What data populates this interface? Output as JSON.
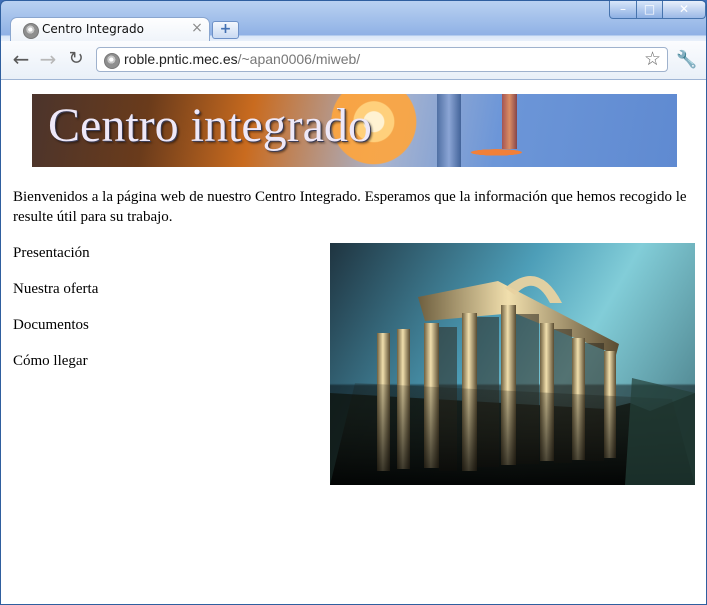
{
  "browser": {
    "tab_title": "Centro Integrado",
    "tab_close": "×",
    "new_tab": "+",
    "window_controls": {
      "minimize": "–",
      "maximize": "□",
      "close": "✕"
    },
    "url_host": "roble.pntic.mec.es",
    "url_path": "/~apan0006/miweb/",
    "icons": {
      "back": "←",
      "forward": "→",
      "reload": "↻",
      "star": "☆",
      "wrench": "🔧"
    }
  },
  "page": {
    "banner_title": "Centro integrado",
    "intro": "Bienvenidos a la página web de nuestro Centro Integrado. Esperamos que la información que hemos recogido le resulte útil para su trabajo.",
    "menu": [
      "Presentación",
      "Nuestra oferta",
      "Documentos",
      "Cómo llegar"
    ]
  }
}
